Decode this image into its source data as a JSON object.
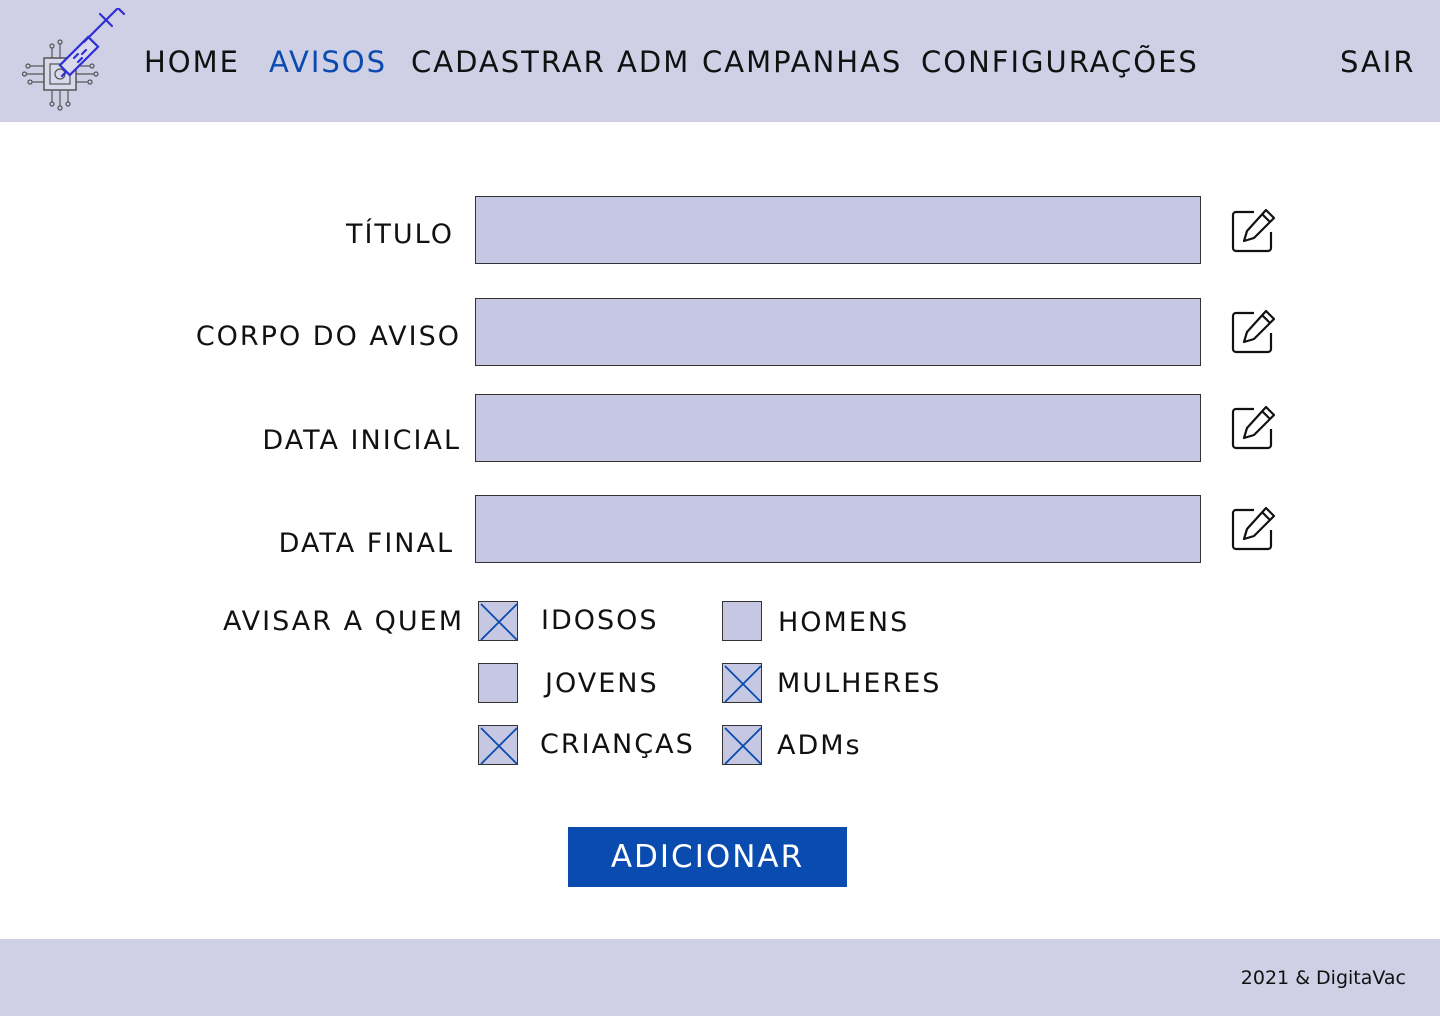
{
  "nav": {
    "items": [
      {
        "label": "HOME"
      },
      {
        "label": "AVISOS",
        "active": true
      },
      {
        "label": "CADASTRAR ADM"
      },
      {
        "label": "CAMPANHAS"
      },
      {
        "label": "CONFIGURAÇÕES"
      }
    ],
    "logout": "SAIR",
    "active_color": "#0a4bb0",
    "bg_color": "#cfcfe6",
    "logo_icon": "syringe-chip-icon"
  },
  "form": {
    "fields": [
      {
        "label": "TÍTULO",
        "value": "",
        "icon": "edit-icon"
      },
      {
        "label": "CORPO DO AVISO",
        "value": "",
        "icon": "edit-icon"
      },
      {
        "label": "DATA INICIAL",
        "value": "",
        "icon": "edit-icon"
      },
      {
        "label": "DATA FINAL",
        "value": "",
        "icon": "edit-icon"
      }
    ],
    "input_color": "#c6c7e2",
    "audience_label": "AVISAR A QUEM",
    "audience": [
      {
        "label": "IDOSOS",
        "checked": true
      },
      {
        "label": "HOMENS",
        "checked": false
      },
      {
        "label": "JOVENS",
        "checked": false
      },
      {
        "label": "MULHERES",
        "checked": true
      },
      {
        "label": "CRIANÇAS",
        "checked": true
      },
      {
        "label": "ADMs",
        "checked": true
      }
    ],
    "submit_label": "ADICIONAR",
    "submit_color": "#0a4bb0"
  },
  "footer": {
    "text": "2021 & DigitaVac"
  }
}
